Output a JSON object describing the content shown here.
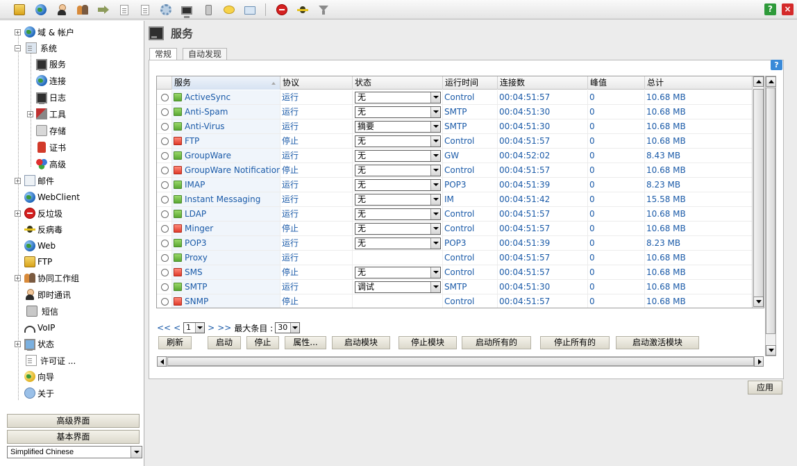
{
  "toolbar": {
    "buttons": [
      "database-icon",
      "globe-icon",
      "user-icon",
      "users-icon",
      "forward-arrow-icon",
      "document-icon",
      "document-lines-icon",
      "gear-icon",
      "monitor-icon",
      "phone-icon",
      "chat-bubble-icon",
      "folder-icon",
      "stop-icon",
      "antivirus-icon",
      "filter-icon"
    ],
    "help_label": "?",
    "close_label": "×"
  },
  "sidebar": {
    "items": [
      {
        "label": "域 & 帐户"
      },
      {
        "label": "系统"
      },
      {
        "label": "服务"
      },
      {
        "label": "连接"
      },
      {
        "label": "日志"
      },
      {
        "label": "工具"
      },
      {
        "label": "存储"
      },
      {
        "label": "证书"
      },
      {
        "label": "高级"
      },
      {
        "label": "邮件"
      },
      {
        "label": "WebClient"
      },
      {
        "label": "反垃圾"
      },
      {
        "label": "反病毒"
      },
      {
        "label": "Web"
      },
      {
        "label": "FTP"
      },
      {
        "label": "协同工作组"
      },
      {
        "label": "即时通讯"
      },
      {
        "label": "短信"
      },
      {
        "label": "VoIP"
      },
      {
        "label": "状态"
      },
      {
        "label": "许可证 ..."
      },
      {
        "label": "向导"
      },
      {
        "label": "关于"
      }
    ],
    "advanced_ui_button": "高级界面",
    "basic_ui_button": "基本界面",
    "language_value": "Simplified Chinese"
  },
  "main": {
    "title": "服务",
    "tabs": [
      "常规",
      "自动发现"
    ],
    "help_label": "?",
    "columns": [
      "服务",
      "协议",
      "状态",
      "运行时间",
      "连接数",
      "峰值",
      "总计"
    ],
    "rows": [
      {
        "name": "ActiveSync",
        "running": true,
        "state": "运行",
        "log": "无",
        "protocol": "Control",
        "uptime": "00:04:51:57",
        "connections": "0",
        "total": "10.68 MB"
      },
      {
        "name": "Anti-Spam",
        "running": true,
        "state": "运行",
        "log": "无",
        "protocol": "SMTP",
        "uptime": "00:04:51:30",
        "connections": "0",
        "total": "10.68 MB"
      },
      {
        "name": "Anti-Virus",
        "running": true,
        "state": "运行",
        "log": "摘要",
        "protocol": "SMTP",
        "uptime": "00:04:51:30",
        "connections": "0",
        "total": "10.68 MB"
      },
      {
        "name": "FTP",
        "running": false,
        "state": "停止",
        "log": "无",
        "protocol": "Control",
        "uptime": "00:04:51:57",
        "connections": "0",
        "total": "10.68 MB"
      },
      {
        "name": "GroupWare",
        "running": true,
        "state": "运行",
        "log": "无",
        "protocol": "GW",
        "uptime": "00:04:52:02",
        "connections": "0",
        "total": "8.43 MB"
      },
      {
        "name": "GroupWare Notification",
        "running": false,
        "state": "停止",
        "log": "无",
        "protocol": "Control",
        "uptime": "00:04:51:57",
        "connections": "0",
        "total": "10.68 MB"
      },
      {
        "name": "IMAP",
        "running": true,
        "state": "运行",
        "log": "无",
        "protocol": "POP3",
        "uptime": "00:04:51:39",
        "connections": "0",
        "total": "8.23 MB"
      },
      {
        "name": "Instant Messaging",
        "running": true,
        "state": "运行",
        "log": "无",
        "protocol": "IM",
        "uptime": "00:04:51:42",
        "connections": "0",
        "total": "15.58 MB"
      },
      {
        "name": "LDAP",
        "running": true,
        "state": "运行",
        "log": "无",
        "protocol": "Control",
        "uptime": "00:04:51:57",
        "connections": "0",
        "total": "10.68 MB"
      },
      {
        "name": "Minger",
        "running": false,
        "state": "停止",
        "log": "无",
        "protocol": "Control",
        "uptime": "00:04:51:57",
        "connections": "0",
        "total": "10.68 MB"
      },
      {
        "name": "POP3",
        "running": true,
        "state": "运行",
        "log": "无",
        "protocol": "POP3",
        "uptime": "00:04:51:39",
        "connections": "0",
        "total": "8.23 MB"
      },
      {
        "name": "Proxy",
        "running": true,
        "state": "运行",
        "log": "",
        "protocol": "Control",
        "uptime": "00:04:51:57",
        "connections": "0",
        "total": "10.68 MB"
      },
      {
        "name": "SMS",
        "running": false,
        "state": "停止",
        "log": "无",
        "protocol": "Control",
        "uptime": "00:04:51:57",
        "connections": "0",
        "total": "10.68 MB"
      },
      {
        "name": "SMTP",
        "running": true,
        "state": "运行",
        "log": "调试",
        "protocol": "SMTP",
        "uptime": "00:04:51:30",
        "connections": "0",
        "total": "10.68 MB"
      },
      {
        "name": "SNMP",
        "running": false,
        "state": "停止",
        "log": "",
        "protocol": "Control",
        "uptime": "00:04:51:57",
        "connections": "0",
        "total": "10.68 MB"
      }
    ],
    "pager": {
      "first": "<<",
      "prev": "<",
      "page": "1",
      "next": ">",
      "last": ">>",
      "max_label": "最大条目 :",
      "max_value": "30"
    },
    "actions": [
      "刷新",
      "启动",
      "停止",
      "属性...",
      "启动模块",
      "停止模块",
      "启动所有的",
      "停止所有的",
      "启动激活模块"
    ],
    "apply_button": "应用"
  }
}
